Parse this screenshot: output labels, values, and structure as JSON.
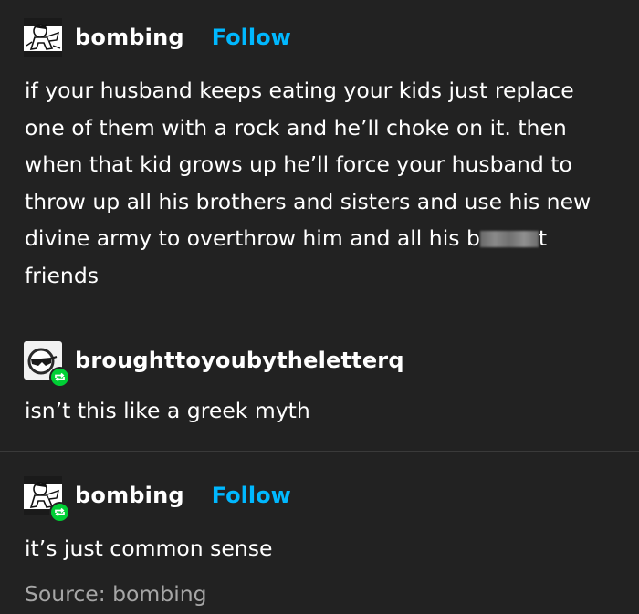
{
  "posts": [
    {
      "username": "bombing",
      "follow_label": "Follow",
      "avatar_icon": "sketch-figure-avatar-icon",
      "text_lines": [
        "if your husband keeps eating your kids just replace",
        "one of them with a rock and he’ll choke on it. then",
        "when that kid grows up he’ll force your husband to",
        "throw up all his brothers and sisters and use his new",
        "divine army to overthrow him and all his b",
        "t",
        "friends"
      ]
    },
    {
      "username": "broughttoyoubytheletterq",
      "avatar_icon": "sunglasses-avatar-icon",
      "badge_icon": "reblog-icon",
      "text": "isn’t this like a greek myth"
    },
    {
      "username": "bombing",
      "follow_label": "Follow",
      "avatar_icon": "sketch-figure-avatar-icon",
      "badge_icon": "reblog-icon",
      "text": "it’s just common sense"
    }
  ],
  "source": "Source: bombing",
  "colors": {
    "background": "#222222",
    "follow": "#00b8ff",
    "reblog_badge": "#00cf35",
    "muted_text": "#a6a6a6"
  }
}
